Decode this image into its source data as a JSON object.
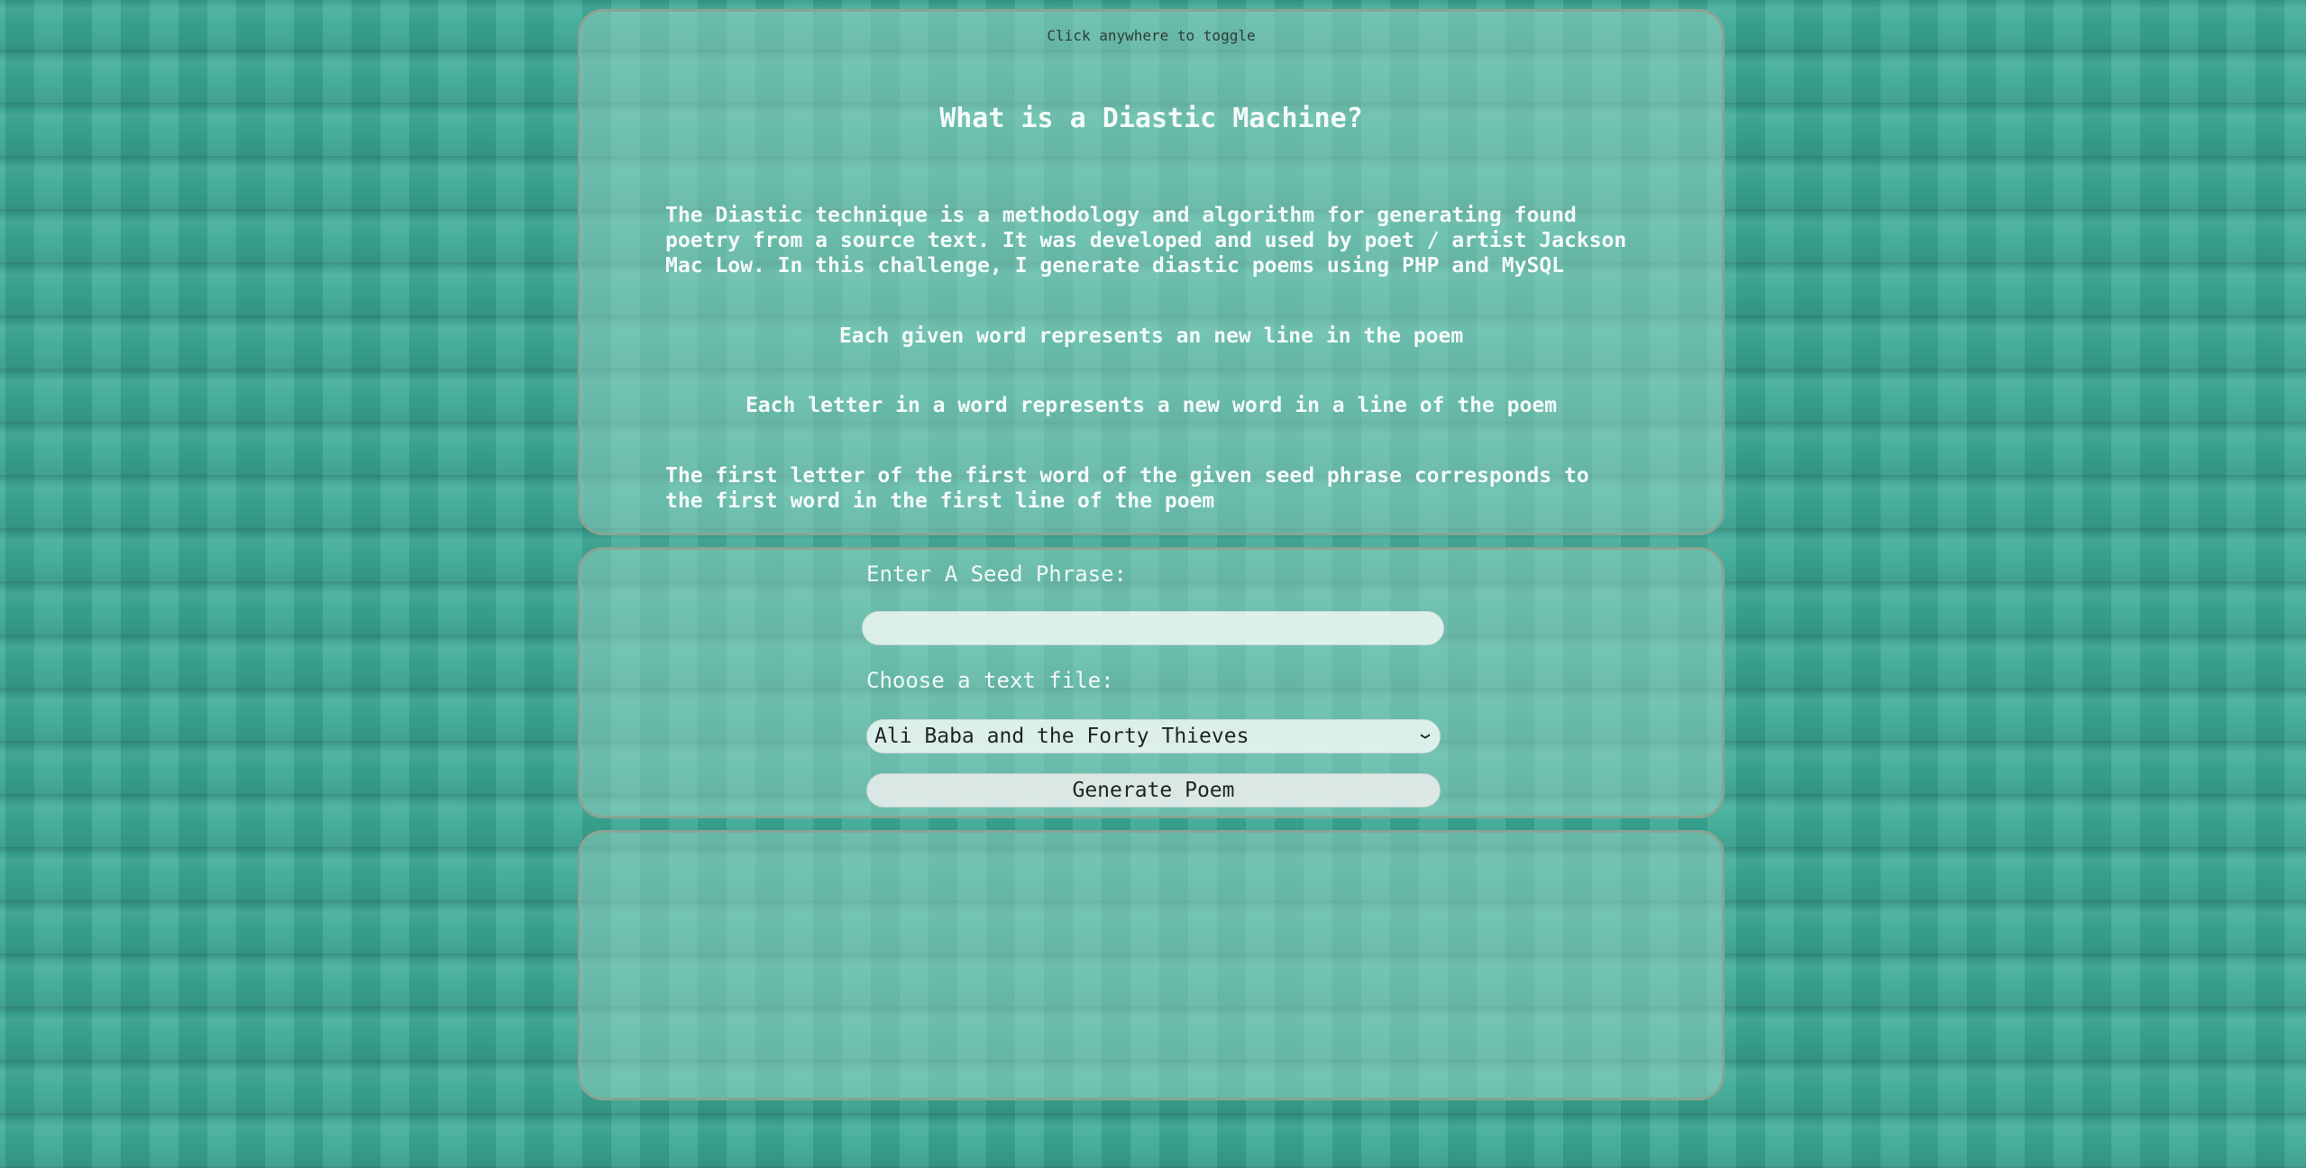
{
  "info": {
    "toggle_hint": "Click anywhere to toggle",
    "title": "What is a Diastic Machine?",
    "paragraphs": [
      "The Diastic technique is a methodology and algorithm for generating found poetry from a source text. It was developed and used by poet / artist Jackson Mac Low. In this challenge, I generate diastic poems using PHP and MySQL",
      "Each given word represents an new line in the poem",
      "Each letter in a word represents a new word in a line of the poem",
      "The first letter of the first word of the given seed phrase corresponds to the first word in the first line of the poem"
    ]
  },
  "form": {
    "seed_label": "Enter A Seed Phrase:",
    "seed_value": "",
    "file_label": "Choose a text file:",
    "file_selected": "Ali Baba and the Forty Thieves",
    "dropdown_icon": "chevron-down-icon",
    "generate_label": "Generate Poem"
  },
  "output": {
    "poem": ""
  }
}
